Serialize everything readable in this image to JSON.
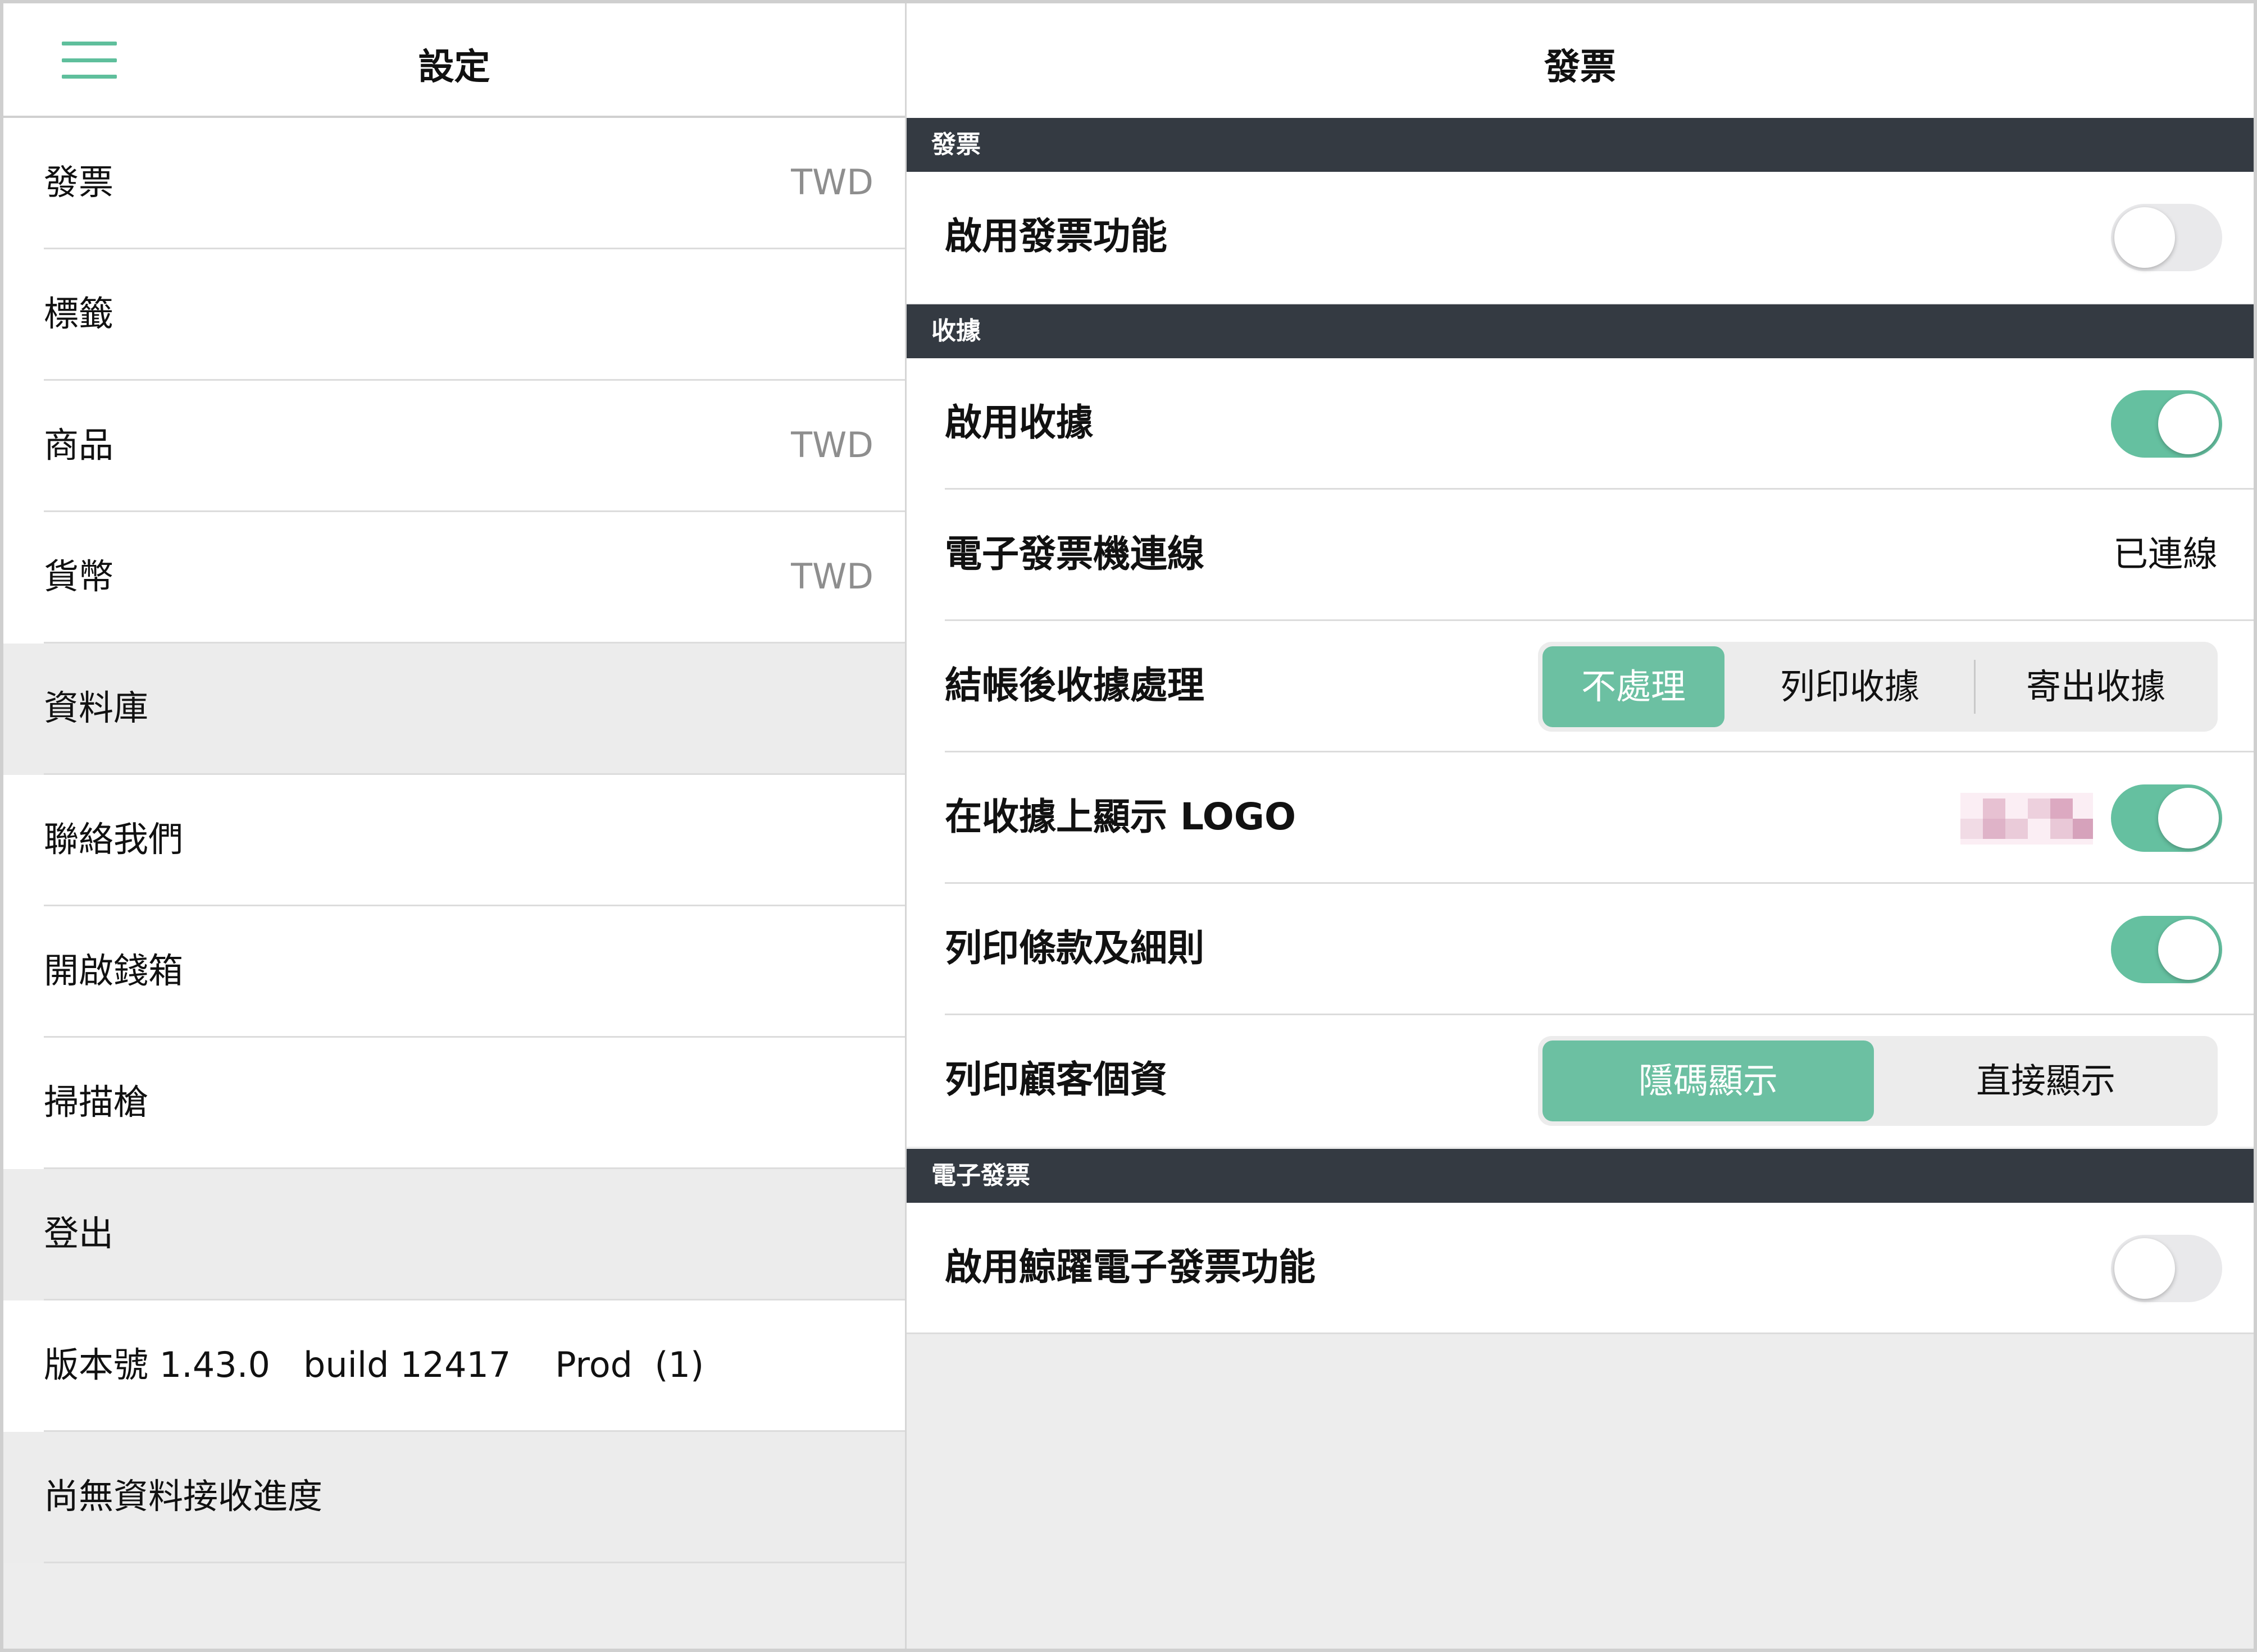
{
  "left_panel": {
    "title": "設定",
    "menu_items": [
      {
        "label": "發票",
        "value": "TWD"
      },
      {
        "label": "標籤",
        "value": ""
      },
      {
        "label": "商品",
        "value": "TWD"
      },
      {
        "label": "貨幣",
        "value": "TWD"
      },
      {
        "label": "資料庫",
        "value": ""
      },
      {
        "label": "聯絡我們",
        "value": ""
      },
      {
        "label": "開啟錢箱",
        "value": ""
      },
      {
        "label": "掃描槍",
        "value": ""
      },
      {
        "label": "登出",
        "value": ""
      },
      {
        "label": "版本號 1.43.0   build 12417    Prod  (1)",
        "value": ""
      },
      {
        "label": "尚無資料接收進度",
        "value": ""
      }
    ]
  },
  "right_panel": {
    "title": "發票",
    "sections": {
      "invoice": {
        "header": "發票",
        "enable_invoice": {
          "label": "啟用發票功能",
          "enabled": false
        }
      },
      "receipt": {
        "header": "收據",
        "enable_receipt": {
          "label": "啟用收據",
          "enabled": true
        },
        "e_invoice_connection": {
          "label": "電子發票機連線",
          "status": "已連線"
        },
        "after_checkout": {
          "label": "結帳後收據處理",
          "options": [
            "不處理",
            "列印收據",
            "寄出收據"
          ],
          "selected": "不處理"
        },
        "show_logo": {
          "label": "在收據上顯示 LOGO",
          "enabled": true
        },
        "print_terms": {
          "label": "列印條款及細則",
          "enabled": true
        },
        "print_customer_info": {
          "label": "列印顧客個資",
          "options": [
            "隱碼顯示",
            "直接顯示"
          ],
          "selected": "隱碼顯示"
        }
      },
      "e_invoice": {
        "header": "電子發票",
        "enable_whale_e_invoice": {
          "label": "啟用鯨躍電子發票功能",
          "enabled": false
        }
      }
    }
  },
  "colors": {
    "accent": "#65c0a0",
    "section_header_bg": "#343a42",
    "panel_grey": "#ededed"
  }
}
